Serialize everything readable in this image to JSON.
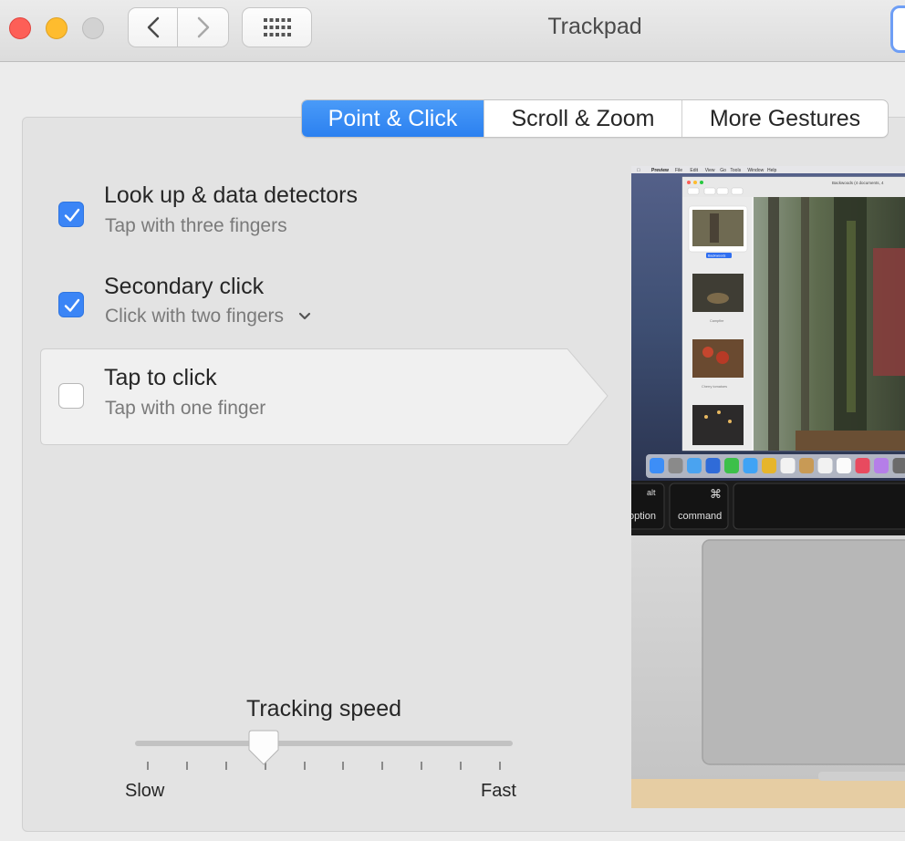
{
  "window": {
    "title": "Trackpad"
  },
  "tabs": [
    {
      "label": "Point & Click",
      "active": true
    },
    {
      "label": "Scroll & Zoom",
      "active": false
    },
    {
      "label": "More Gestures",
      "active": false
    }
  ],
  "options": [
    {
      "title": "Look up & data detectors",
      "subtitle": "Tap with three fingers",
      "checked": true
    },
    {
      "title": "Secondary click",
      "subtitle": "Click with two fingers",
      "checked": true
    },
    {
      "title": "Tap to click",
      "subtitle": "Tap with one finger",
      "checked": false
    }
  ],
  "tracking": {
    "label": "Tracking speed",
    "min_label": "Slow",
    "max_label": "Fast",
    "value_fraction": 0.34,
    "tick_count": 10
  },
  "preview": {
    "menu_app": "Preview",
    "menu_items": [
      "File",
      "Edit",
      "View",
      "Go",
      "Tools",
      "Window",
      "Help"
    ],
    "doc_title": "Backwoods (4 documents, 4",
    "thumbs": [
      "Backwoods",
      "Campfire",
      "Cherry tomatoes"
    ],
    "keys": [
      {
        "top": "alt",
        "bottom": "option"
      },
      {
        "top": "⌘",
        "bottom": "command"
      }
    ]
  },
  "colors": {
    "accent": "#3b85f6",
    "window_bg": "#ececec",
    "panel_bg": "#e3e3e3"
  }
}
